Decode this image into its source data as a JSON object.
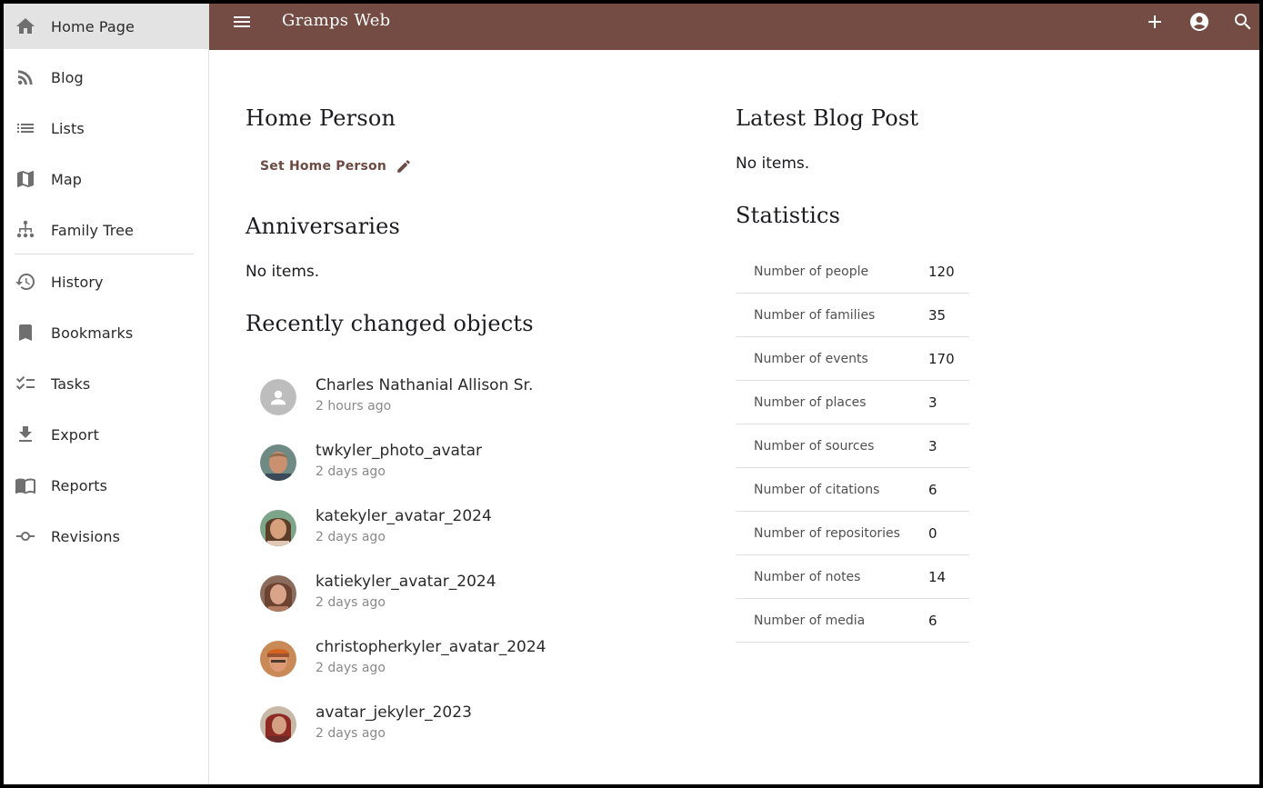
{
  "app": {
    "title": "Gramps Web"
  },
  "sidebar": {
    "items": [
      {
        "label": "Home Page",
        "icon": "home-icon",
        "active": true
      },
      {
        "label": "Blog",
        "icon": "rss-icon"
      },
      {
        "label": "Lists",
        "icon": "list-icon"
      },
      {
        "label": "Map",
        "icon": "map-icon"
      },
      {
        "label": "Family Tree",
        "icon": "family-tree-icon"
      },
      {
        "label": "History",
        "icon": "history-icon"
      },
      {
        "label": "Bookmarks",
        "icon": "bookmark-icon"
      },
      {
        "label": "Tasks",
        "icon": "checklist-icon"
      },
      {
        "label": "Export",
        "icon": "download-icon"
      },
      {
        "label": "Reports",
        "icon": "book-icon"
      },
      {
        "label": "Revisions",
        "icon": "commit-icon"
      }
    ]
  },
  "header": {
    "menu_icon": "menu-icon",
    "add_icon": "plus-icon",
    "account_icon": "account-circle-icon",
    "search_icon": "search-icon",
    "bar_color": "#744c43"
  },
  "home_person": {
    "heading": "Home Person",
    "set_label": "Set Home Person",
    "set_icon": "pencil-icon"
  },
  "anniversaries": {
    "heading": "Anniversaries",
    "empty": "No items."
  },
  "recent": {
    "heading": "Recently changed objects",
    "items": [
      {
        "title": "Charles Nathanial Allison Sr.",
        "time": "2 hours ago",
        "avatar": "person-placeholder-icon"
      },
      {
        "title": "twkyler_photo_avatar",
        "time": "2 days ago",
        "avatar": "photo-avatar"
      },
      {
        "title": "katekyler_avatar_2024",
        "time": "2 days ago",
        "avatar": "photo-avatar"
      },
      {
        "title": "katiekyler_avatar_2024",
        "time": "2 days ago",
        "avatar": "photo-avatar"
      },
      {
        "title": "christopherkyler_avatar_2024",
        "time": "2 days ago",
        "avatar": "photo-avatar"
      },
      {
        "title": "avatar_jekyler_2023",
        "time": "2 days ago",
        "avatar": "photo-avatar"
      }
    ]
  },
  "blog": {
    "heading": "Latest Blog Post",
    "empty": "No items."
  },
  "statistics": {
    "heading": "Statistics",
    "rows": [
      {
        "label": "Number of people",
        "value": "120"
      },
      {
        "label": "Number of families",
        "value": "35"
      },
      {
        "label": "Number of events",
        "value": "170"
      },
      {
        "label": "Number of places",
        "value": "3"
      },
      {
        "label": "Number of sources",
        "value": "3"
      },
      {
        "label": "Number of citations",
        "value": "6"
      },
      {
        "label": "Number of repositories",
        "value": "0"
      },
      {
        "label": "Number of notes",
        "value": "14"
      },
      {
        "label": "Number of media",
        "value": "6"
      }
    ]
  }
}
